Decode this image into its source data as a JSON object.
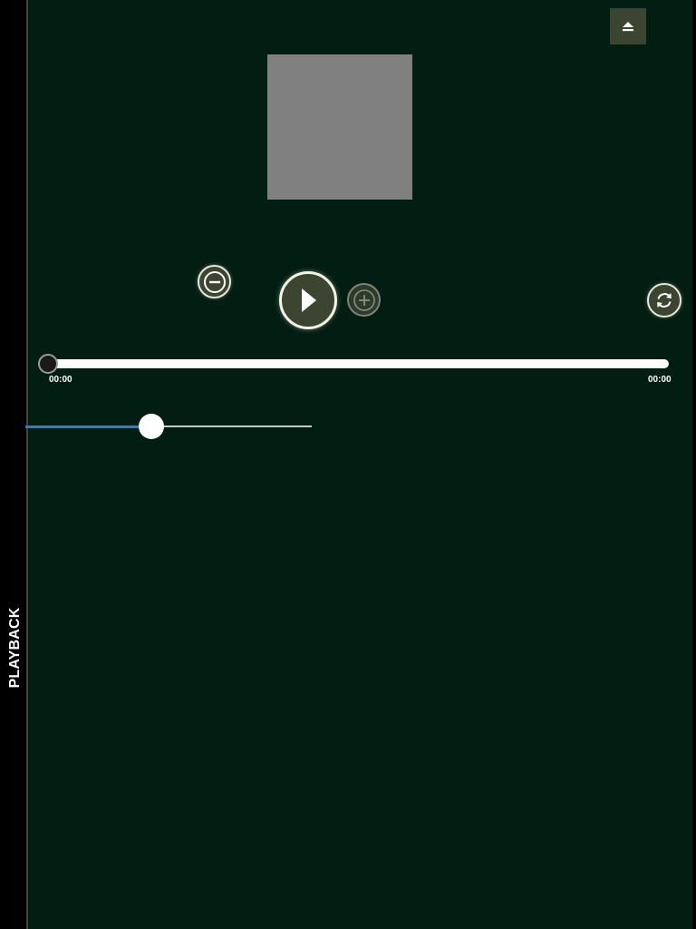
{
  "sidebar": {
    "tab_label": "PLAYBACK"
  },
  "toolbar": {
    "eject_icon": "eject-icon"
  },
  "player": {
    "artwork": "album-artwork-placeholder",
    "controls": {
      "minus_icon": "minus-circle-icon",
      "play_icon": "play-icon",
      "plus_icon": "plus-circle-icon",
      "repeat_icon": "repeat-icon",
      "plus_enabled": false
    },
    "seek": {
      "elapsed": "00:00",
      "total": "00:00",
      "progress": 0
    },
    "volume": {
      "level": 0.44
    }
  },
  "colors": {
    "background": "#021d11",
    "rail": "#000000",
    "button_fill": "#3b4530",
    "button_ring": "#e8e6d8",
    "accent_blue": "#2f7bd6",
    "track_white": "#ffffff",
    "artwork_gray": "#808080"
  }
}
